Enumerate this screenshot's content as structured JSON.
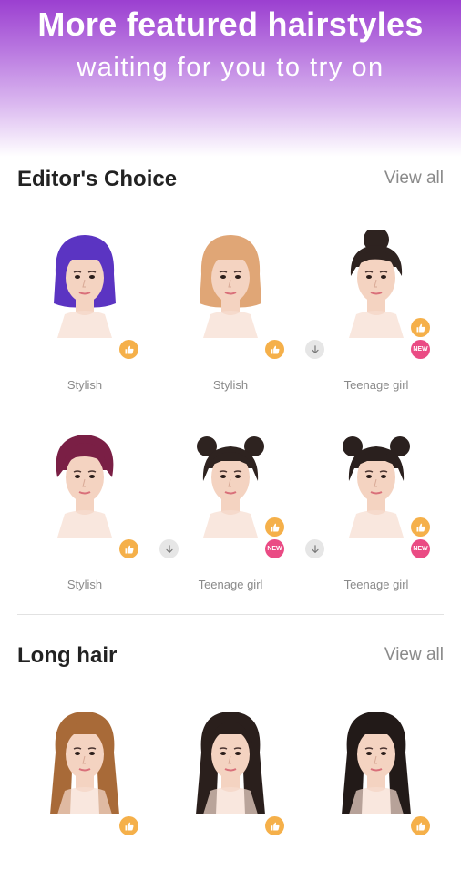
{
  "banner": {
    "title": "More featured hairstyles",
    "subtitle": "waiting for you to try on"
  },
  "sections": [
    {
      "title": "Editor's Choice",
      "view_all": "View all",
      "items": [
        {
          "label": "Stylish",
          "hair_color": "#5b34c2",
          "style": "bob",
          "badges": [
            "like"
          ]
        },
        {
          "label": "Stylish",
          "hair_color": "#e0a676",
          "style": "bob",
          "badges": [
            "like"
          ]
        },
        {
          "label": "Teenage girl",
          "hair_color": "#2e2320",
          "style": "bun",
          "badges": [
            "download",
            "like",
            "new"
          ]
        },
        {
          "label": "Stylish",
          "hair_color": "#7a1f45",
          "style": "short",
          "badges": [
            "like"
          ]
        },
        {
          "label": "Teenage girl",
          "hair_color": "#2e2320",
          "style": "knots",
          "badges": [
            "download",
            "like",
            "new"
          ]
        },
        {
          "label": "Teenage girl",
          "hair_color": "#2a201e",
          "style": "twin-buns",
          "badges": [
            "download",
            "like",
            "new"
          ]
        }
      ]
    },
    {
      "title": "Long hair",
      "view_all": "View all",
      "items": [
        {
          "label": "",
          "hair_color": "#a86a38",
          "style": "long-wavy",
          "badges": [
            "like"
          ]
        },
        {
          "label": "",
          "hair_color": "#2a1f1c",
          "style": "long",
          "badges": [
            "like"
          ]
        },
        {
          "label": "",
          "hair_color": "#221a18",
          "style": "ponytail",
          "badges": [
            "like"
          ]
        }
      ]
    }
  ],
  "icons": {
    "like": "thumbs-up-icon",
    "new": "new-badge-icon",
    "download": "download-arrow-icon"
  },
  "badge_text": {
    "new": "NEW"
  },
  "colors": {
    "accent_purple": "#9b3fd0",
    "like": "#f5b04a",
    "new": "#ea4b84"
  }
}
